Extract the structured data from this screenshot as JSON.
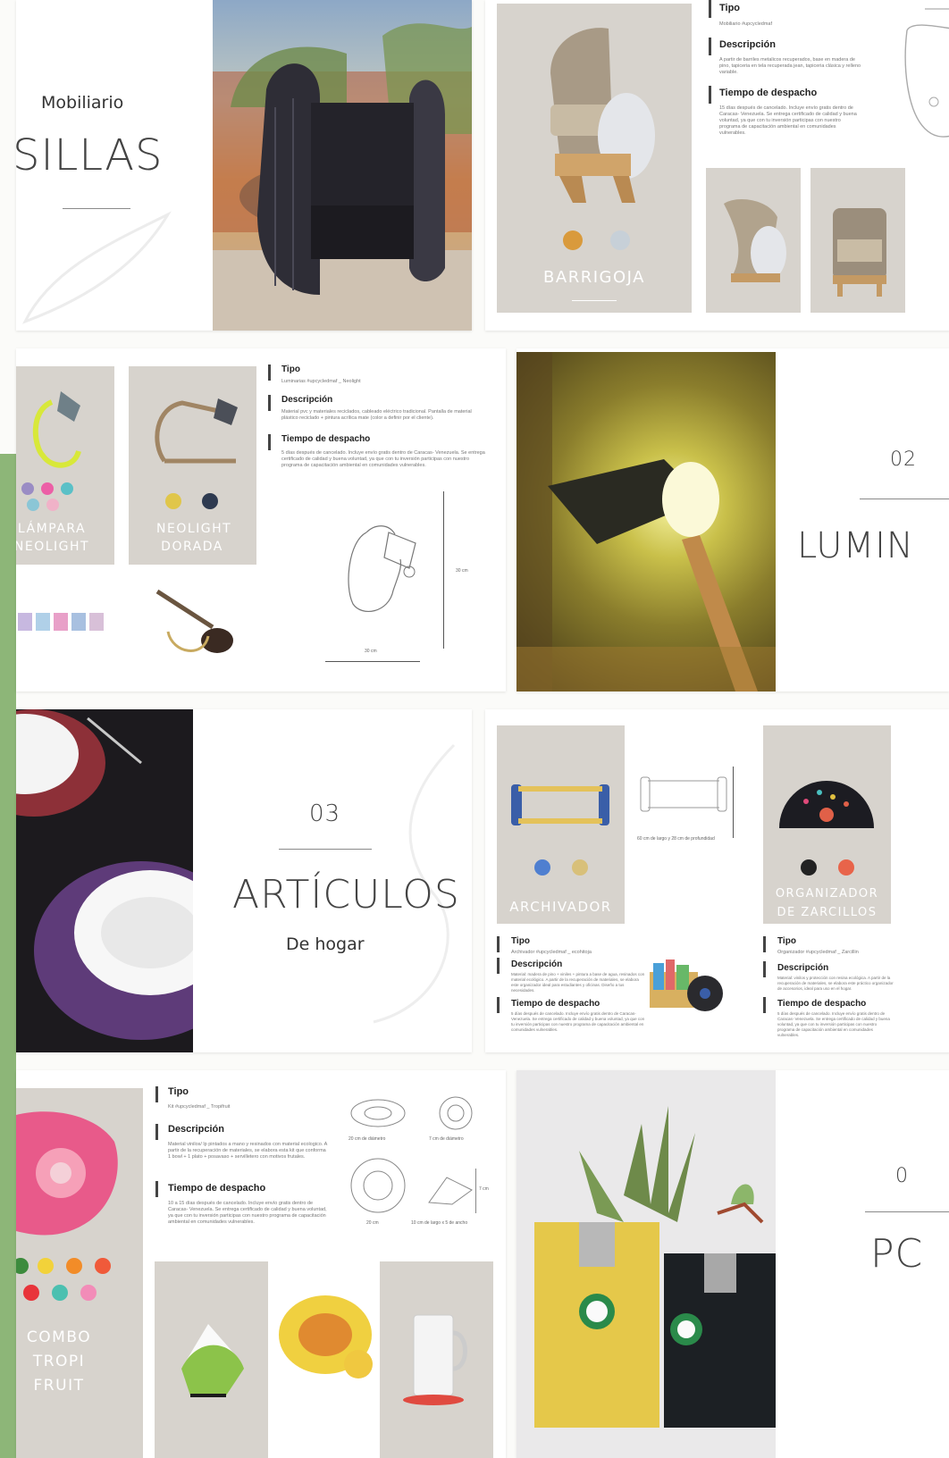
{
  "sillas": {
    "category": "Mobiliario",
    "title": "SILLAS"
  },
  "barrigoja": {
    "tipo_h": "Tipo",
    "tipo_t": "Mobiliario #upcycledmaf",
    "desc_h": "Descripción",
    "desc_t": "A partir de barriles metalicos recuperados, base en madera de pino, tapiceria en tela recuperada jean, tapiceria clásica y relleno variable.",
    "time_h": "Tiempo de despacho",
    "time_t": "15 días después de cancelado. Incluye envío gratis dentro de Caracas- Venezuela. Se entrega certificado de calidad y buena voluntad, ya que con tu inversión participas con nuestro programa de capacitación ambiental en comunidades vulnerables.",
    "name": "BARRIGOJA",
    "colors": [
      "#d99a3c",
      "#c7d0d8"
    ]
  },
  "neolight": {
    "lamp1": "LÁMPARA NEOLIGHT",
    "lamp2": "NEOLIGHT DORADA",
    "lamp1_colors": [
      "#9a8cc4",
      "#ec5fa6",
      "#5ac0c7",
      "#8bc6d6",
      "#f0b2c8"
    ],
    "lamp2_colors": [
      "#e0c64a",
      "#2e3a50"
    ],
    "tipo_h": "Tipo",
    "tipo_t": "Luminarias #upcycledmaf _ Neolight",
    "desc_h": "Descripción",
    "desc_t": "Material pvc y materiales reciclados, cableado eléctrico tradicional. Pantalla de material plástico reciclado + pintura acrílica mate (color a definir por el cliente).",
    "time_h": "Tiempo de despacho",
    "time_t": "5 días después de cancelado. Incluye envío gratis dentro de Caracas- Venezuela. Se entrega certificado de calidad y buena voluntad, ya que con tu inversión participas con nuestro programa de capacitación ambiental en comunidades vulnerables.",
    "dim_w": "30 cm",
    "dim_h": "30 cm"
  },
  "luminarias": {
    "number": "02",
    "title": "LUMIN"
  },
  "articulos": {
    "number": "03",
    "title": "ARTÍCULOS",
    "subtitle": "De hogar"
  },
  "archivador": {
    "name": "ARCHIVADOR",
    "colors": [
      "#4f7fd0",
      "#d8c07a"
    ],
    "dims": "60 cm de largo y 28 cm de profundidad",
    "tipo_h": "Tipo",
    "tipo_t": "Archivador #upcycledmaf _ ecohitoja",
    "desc_h": "Descripción",
    "desc_t": "Material: madera de pino + viniles + pintura a base de agua, resinados con material ecológico. A partir de la recuperación de materiales, se elabora este organizador ideal para estudiantes y oficinas. Diseño a tus necesidades.",
    "time_h": "Tiempo de despacho",
    "time_t": "5 días después de cancelado. Incluye envío gratis dentro de Caracas- Venezuela. Se entrega certificado de calidad y buena voluntad, ya que con tu inversión participas con nuestro programa de capacitación ambiental en comunidades vulnerables."
  },
  "zarcillos": {
    "name": "ORGANIZADOR DE ZARCILLOS",
    "colors": [
      "#222222",
      "#e8644a"
    ],
    "tipo_h": "Tipo",
    "tipo_t": "Organizador #upcycledmaf _ Zarcillin",
    "desc_h": "Descripción",
    "desc_t": "Material: vinilos y protección con resina ecológica. A partir de la recuperación de materiales, se elabora este práctico organizador de accesorios, ideal para uso en el hogar.",
    "time_h": "Tiempo de despacho",
    "time_t": "5 días después de cancelado. Incluye envío gratis dentro de Caracas- Venezuela. Se entrega certificado de calidad y buena voluntad, ya que con tu inversión participas con nuestro programa de capacitación ambiental en comunidades vulnerables."
  },
  "tropi": {
    "name": "COMBO TROPI FRUIT",
    "colors": [
      "#3d8b3d",
      "#f2d23a",
      "#f28c28",
      "#f05a3a",
      "#e8343a",
      "#4bc0b0",
      "#f28cb8"
    ],
    "tipo_h": "Tipo",
    "tipo_t": "Kit #upcycledmaf _ Tropifruit",
    "desc_h": "Descripción",
    "desc_t": "Material vinilos/ lp pintados a mano y resinados con material ecologico. A partir de la recuperación de materiales, se elabora esta kit que conforma 1 bowl + 1 plato + posavaso + servilletero con motivos frutales.",
    "time_h": "Tiempo de despacho",
    "time_t": "10 a 15 días después de cancelado. Incluye envío gratis dentro de Caracas- Venezuela. Se entrega certificado de calidad y buena voluntad, ya que con tu inversión participas con nuestro programa de capacitación ambiental en comunidades vulnerables.",
    "dim1": "20 cm de diámetro",
    "dim2": "7 cm de diámetro",
    "dim3": "20 cm",
    "dim4": "10 cm de largo x 5 de ancho",
    "dim5": "7 cm"
  },
  "porta": {
    "number": "0",
    "title": "PC"
  }
}
